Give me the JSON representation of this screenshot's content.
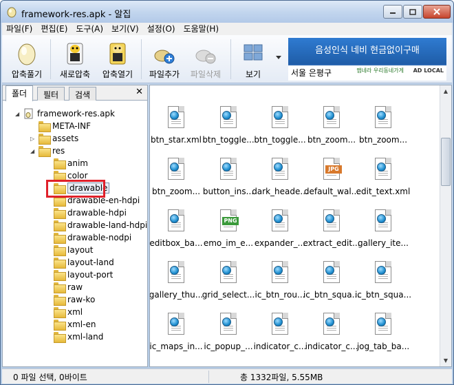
{
  "window": {
    "title": "framework-res.apk - 알집"
  },
  "menu": [
    "파일(F)",
    "편집(E)",
    "도구(A)",
    "보기(V)",
    "설정(O)",
    "도움말(H)"
  ],
  "toolbar": {
    "extract": "압축풀기",
    "new_archive": "새로압축",
    "open_archive": "압축열기",
    "add_file": "파일추가",
    "delete_file": "파일삭제",
    "view": "보기"
  },
  "ad": {
    "headline": "음성인식 네비 현금없이구매",
    "location": "서울 은평구",
    "brand1": "맵네라 우리동네가게",
    "brand2": "AD LOCAL"
  },
  "left_tabs": [
    "폴더",
    "필터",
    "검색"
  ],
  "tree": {
    "root": "framework-res.apk",
    "meta_inf": "META-INF",
    "assets": "assets",
    "res": "res",
    "children": [
      "anim",
      "color",
      "drawable",
      "drawable-en-hdpi",
      "drawable-hdpi",
      "drawable-land-hdpi",
      "drawable-nodpi",
      "layout",
      "layout-land",
      "layout-port",
      "raw",
      "raw-ko",
      "xml",
      "xml-en",
      "xml-land"
    ]
  },
  "files": [
    {
      "name": "btn_star.xml",
      "type": "xml"
    },
    {
      "name": "btn_toggle...",
      "type": "xml"
    },
    {
      "name": "btn_toggle...",
      "type": "xml"
    },
    {
      "name": "btn_zoom...",
      "type": "xml"
    },
    {
      "name": "btn_zoom...",
      "type": "xml"
    },
    {
      "name": "btn_zoom...",
      "type": "xml"
    },
    {
      "name": "button_ins...",
      "type": "xml"
    },
    {
      "name": "dark_heade...",
      "type": "xml"
    },
    {
      "name": "default_wal...",
      "type": "jpg"
    },
    {
      "name": "edit_text.xml",
      "type": "xml"
    },
    {
      "name": "editbox_ba...",
      "type": "xml"
    },
    {
      "name": "emo_im_e...",
      "type": "png"
    },
    {
      "name": "expander_...",
      "type": "xml"
    },
    {
      "name": "extract_edit...",
      "type": "xml"
    },
    {
      "name": "gallery_ite...",
      "type": "xml"
    },
    {
      "name": "gallery_thu...",
      "type": "xml"
    },
    {
      "name": "grid_select...",
      "type": "xml"
    },
    {
      "name": "ic_btn_rou...",
      "type": "xml"
    },
    {
      "name": "ic_btn_squa...",
      "type": "xml"
    },
    {
      "name": "ic_btn_squa...",
      "type": "xml"
    },
    {
      "name": "ic_maps_in...",
      "type": "xml"
    },
    {
      "name": "ic_popup_...",
      "type": "xml"
    },
    {
      "name": "indicator_c...",
      "type": "xml"
    },
    {
      "name": "indicator_c...",
      "type": "xml"
    },
    {
      "name": "jog_tab_ba...",
      "type": "xml"
    }
  ],
  "badges": {
    "png": "PNG",
    "jpg": "JPG"
  },
  "status": {
    "selection": "0 파일 선택,  0바이트",
    "total": "총 1332파일,  5.55MB"
  }
}
